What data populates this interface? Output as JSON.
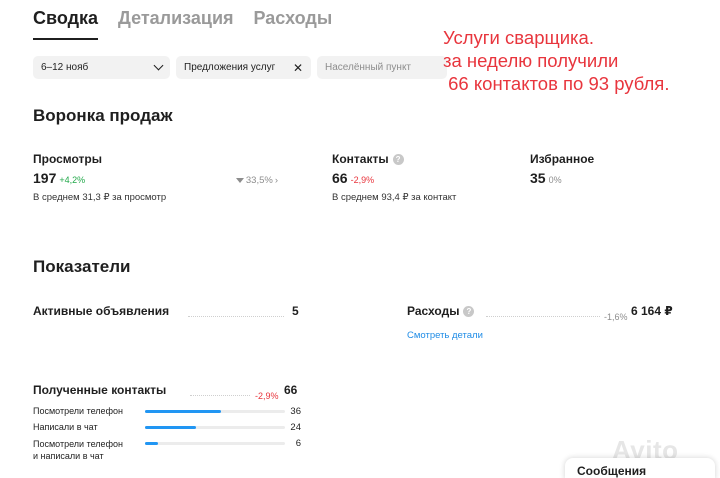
{
  "tabs": [
    {
      "label": "Сводка",
      "active": true
    },
    {
      "label": "Детализация",
      "active": false
    },
    {
      "label": "Расходы",
      "active": false
    }
  ],
  "filters": {
    "period": "6–12 нояб",
    "service": "Предложения услуг",
    "place_placeholder": "Населённый пункт"
  },
  "annotation": "Услуги сварщика.\nза неделю получили\n 66 контактов по 93 рубля.",
  "funnel": {
    "title": "Воронка продаж",
    "views": {
      "label": "Просмотры",
      "value": "197",
      "delta": "+4,2%",
      "avg": "В среднем 31,3 ₽ за просмотр",
      "conversion": "33,5%"
    },
    "contacts": {
      "label": "Контакты",
      "value": "66",
      "delta": "-2,9%",
      "avg": "В среднем 93,4 ₽ за контакт"
    },
    "favorites": {
      "label": "Избранное",
      "value": "35",
      "delta": "0%"
    }
  },
  "indicators": {
    "title": "Показатели",
    "active_ads": {
      "label": "Активные объявления",
      "value": "5"
    },
    "expenses": {
      "label": "Расходы",
      "delta": "-1,6%",
      "value": "6 164 ₽",
      "link": "Смотреть детали"
    },
    "received_contacts": {
      "label": "Полученные контакты",
      "delta": "-2,9%",
      "value": "66",
      "rows": [
        {
          "label": "Посмотрели телефон",
          "value": "36",
          "fraction": 0.545
        },
        {
          "label": "Написали в чат",
          "value": "24",
          "fraction": 0.364
        },
        {
          "label": "Посмотрели телефон",
          "label2": "и написали в чат",
          "value": "6",
          "fraction": 0.091
        }
      ]
    }
  },
  "colors": {
    "accent": "#1f8ce6",
    "bar": "#2196f3",
    "positive": "#22a84a",
    "negative": "#e8353d"
  },
  "watermark": "Avito",
  "messages": "Сообщения"
}
